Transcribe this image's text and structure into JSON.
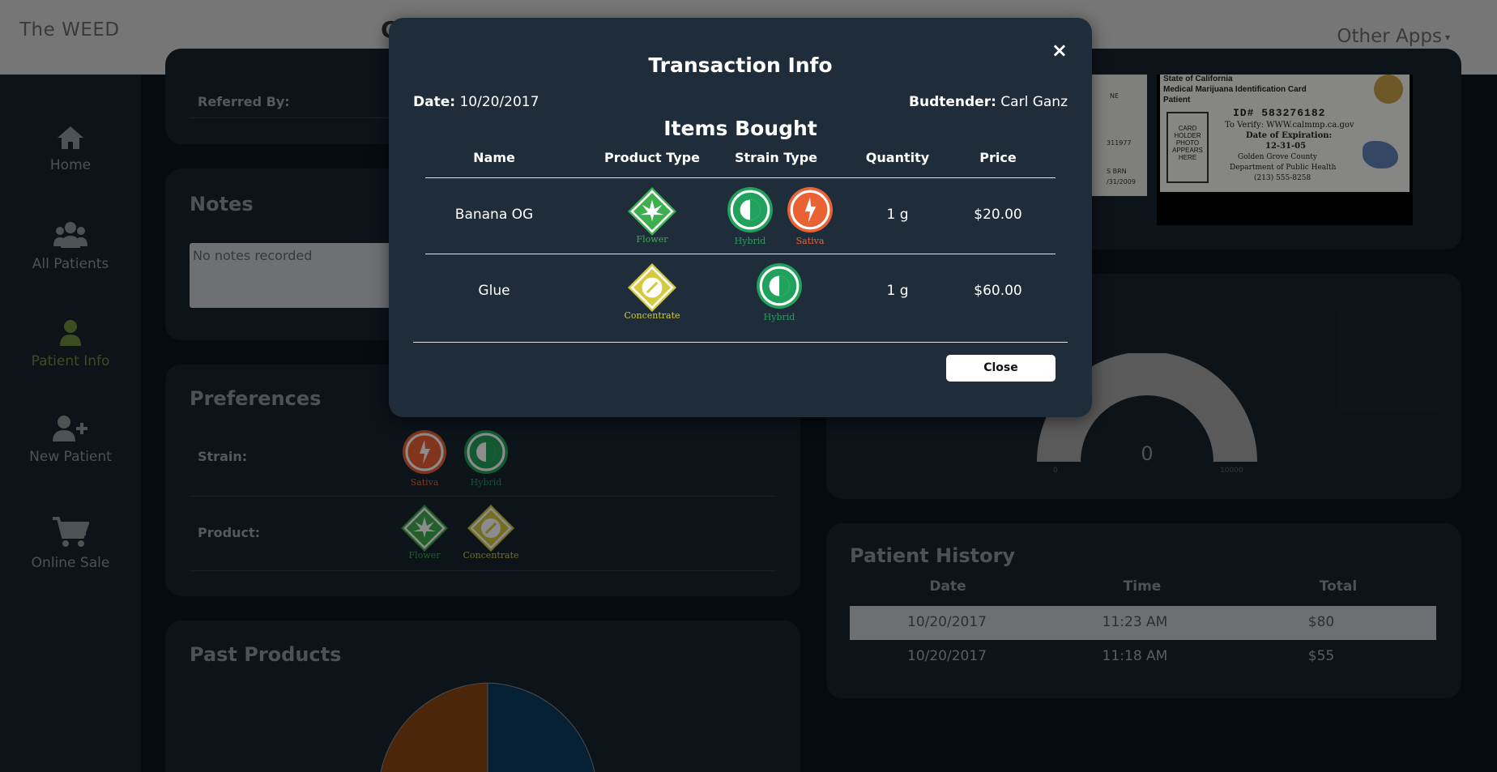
{
  "topbar": {
    "brand": "The WEED",
    "other_apps": "Other Apps",
    "partial_letter": "C"
  },
  "sidebar": {
    "items": [
      {
        "label": "Home"
      },
      {
        "label": "All Patients"
      },
      {
        "label": "Patient Info"
      },
      {
        "label": "New Patient"
      },
      {
        "label": "Online Sale"
      }
    ]
  },
  "patient": {
    "referred_by_label": "Referred By:",
    "notes_title": "Notes",
    "notes_placeholder": "No notes recorded",
    "preferences_title": "Preferences",
    "strain_label": "Strain:",
    "product_label": "Product:",
    "strain_badges": [
      {
        "name": "Sativa"
      },
      {
        "name": "Hybrid"
      }
    ],
    "product_badges": [
      {
        "name": "Flower"
      },
      {
        "name": "Concentrate"
      }
    ],
    "past_products_title": "Past Products"
  },
  "id_card": {
    "line1": "State of California",
    "line2": "Medical Marijuana Identification Card",
    "line3": "Patient",
    "id_number": "ID# 583276182",
    "verify": "To Verify: WWW.calmmp.ca.gov",
    "expiration_label": "Date of Expiration:",
    "expiration": "12-31-05",
    "county": "Golden Grove County",
    "dept": "Department of Public Health",
    "phone": "(213) 555-8258",
    "photo_box": "CARD HOLDER PHOTO APPEARS HERE",
    "left_card_fragments": [
      "NE",
      "311977",
      "S BRN",
      "/31/2009"
    ]
  },
  "gauge": {
    "value": "0",
    "min": "0",
    "max": "10000",
    "fraction": 0
  },
  "history": {
    "title": "Patient History",
    "columns": [
      "Date",
      "Time",
      "Total"
    ],
    "rows": [
      {
        "date": "10/20/2017",
        "time": "11:23 AM",
        "total": "$80"
      },
      {
        "date": "10/20/2017",
        "time": "11:18 AM",
        "total": "$55"
      }
    ]
  },
  "modal": {
    "title": "Transaction Info",
    "date_label": "Date:",
    "date": "10/20/2017",
    "budtender_label": "Budtender:",
    "budtender": "Carl Ganz",
    "items_title": "Items Bought",
    "columns": [
      "Name",
      "Product Type",
      "Strain Type",
      "Quantity",
      "Price"
    ],
    "items": [
      {
        "name": "Banana OG",
        "product": "Flower",
        "strains": [
          "Hybrid",
          "Sativa"
        ],
        "quantity": "1 g",
        "price": "$20.00"
      },
      {
        "name": "Glue",
        "product": "Concentrate",
        "strains": [
          "Hybrid"
        ],
        "quantity": "1 g",
        "price": "$60.00"
      }
    ],
    "close_label": "Close",
    "close_x": "×"
  },
  "colors": {
    "flower": "#3fae4f",
    "hybrid": "#21a25c",
    "sativa": "#ea6234",
    "concentrate": "#d4c93f",
    "active_nav": "#6a8e3c",
    "pie_orange": "#8b4513",
    "pie_blue": "#0b3d5e"
  }
}
